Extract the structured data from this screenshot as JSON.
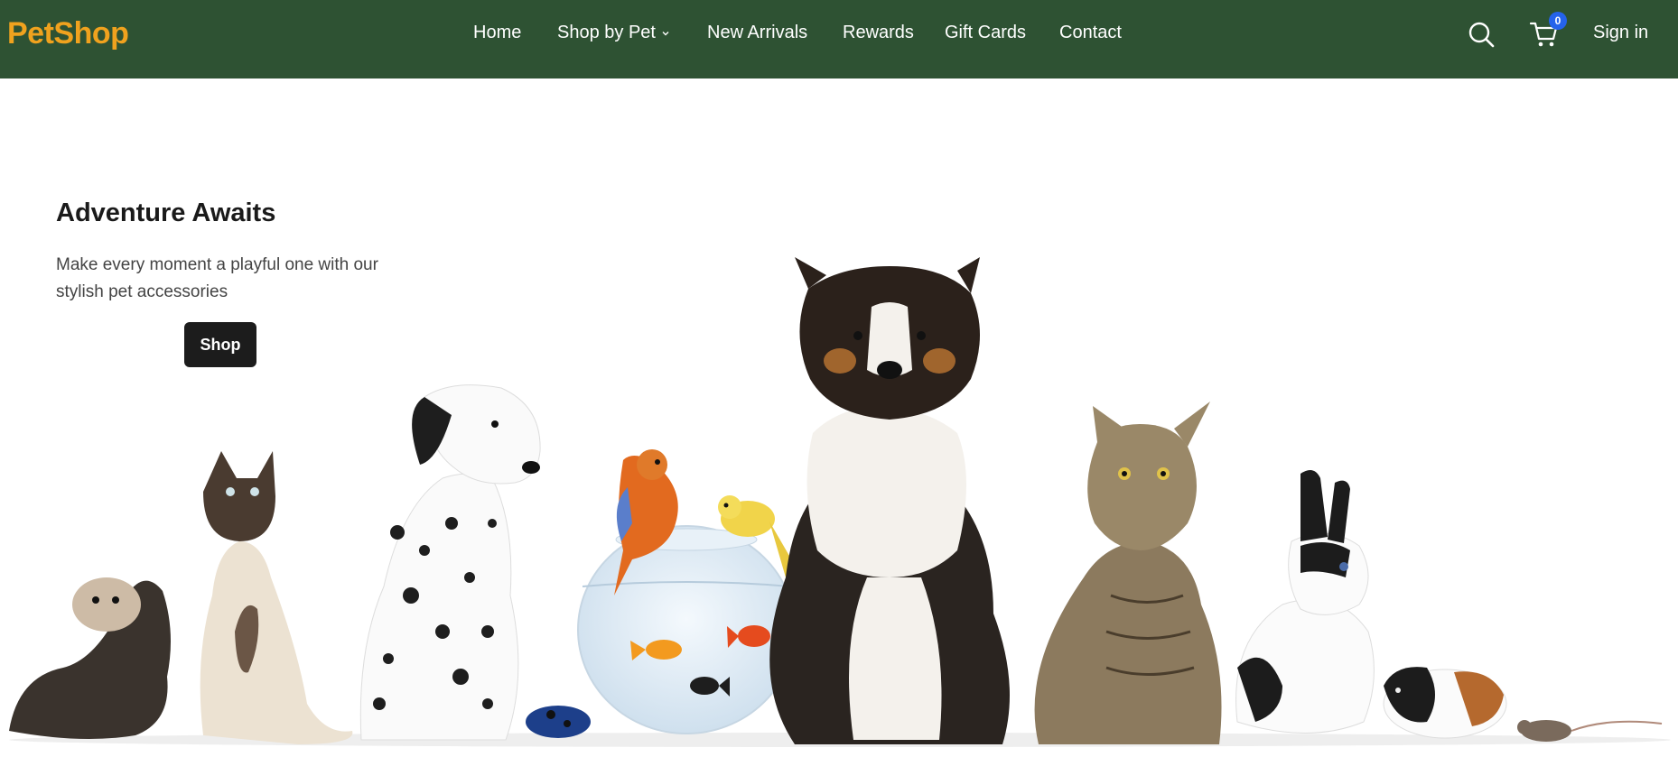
{
  "header": {
    "logo": "PetShop",
    "nav": [
      {
        "label": "Home"
      },
      {
        "label": "Shop by Pet"
      },
      {
        "label": "New Arrivals"
      },
      {
        "label": "Rewards"
      },
      {
        "label": "Gift Cards"
      },
      {
        "label": "Contact"
      }
    ],
    "cart_count": "0",
    "sign_in": "Sign in",
    "icons": {
      "search": "search-icon",
      "cart": "cart-icon",
      "dropdown": "chevron-down-icon"
    },
    "colors": {
      "bg": "#2e5233",
      "logo": "#f0a21e",
      "badge": "#2563eb"
    }
  },
  "hero": {
    "title": "Adventure Awaits",
    "subtitle": "Make every moment a playful one with our stylish pet accessories",
    "button": "Shop",
    "animals": [
      "ferret",
      "siamese cat",
      "dalmatian",
      "frog",
      "fishbowl",
      "parrot",
      "canary",
      "goldfish",
      "collie",
      "tabby cat",
      "rabbit",
      "guinea pig",
      "mouse"
    ]
  }
}
